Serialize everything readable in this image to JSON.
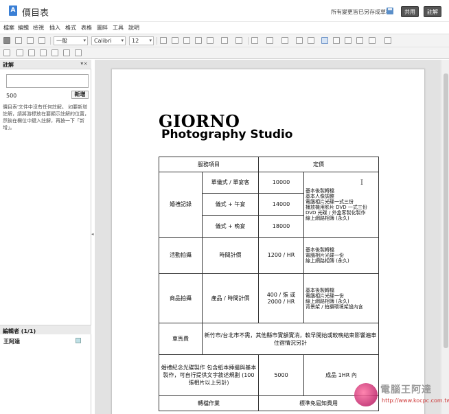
{
  "app": {
    "doc_icon": "A",
    "doc_title": "價目表",
    "save_status": "所有變更皆已另存成草稿",
    "share_label": "共用",
    "comment_label": "註解"
  },
  "menu": [
    "檔案",
    "編輯",
    "檢視",
    "插入",
    "格式",
    "表格",
    "圖畔",
    "工具",
    "說明"
  ],
  "toolbar": {
    "style_value": "一般",
    "font_value": "Calibri",
    "size_value": "12"
  },
  "comments_panel": {
    "title": "註解",
    "count": "500",
    "add_button": "新增",
    "hint": "價目表'文件中沒有任何註解。 如要新增註解，請將游標放在要顯示註解的位置，然後在欄位中鍵入註解，再按一下「新增」。",
    "editors_title": "編輯者 (1/1)",
    "editor_name": "王阿達",
    "editor_color": "#bfe0e6"
  },
  "document": {
    "brand_line1": "GIORNO",
    "brand_line2": "Photography Studio",
    "table": {
      "header_service": "服務項目",
      "header_price": "定價",
      "wedding_label": "婚禮記錄",
      "wedding_rows": [
        {
          "item": "單儀式 / 單宴客",
          "price": "10000"
        },
        {
          "item": "儀式 + 午宴",
          "price": "14000"
        },
        {
          "item": "儀式 + 晚宴",
          "price": "18000"
        }
      ],
      "wedding_details": [
        "基本後製轉檔",
        "基本人像調整",
        "電腦相片光碟一式三份",
        "播放機用影片 DVD 一式三份",
        "DVD 光碟 / 外盒客製化製作",
        "線上網路相簿 (永久)"
      ],
      "event_label": "活動拍攝",
      "event_item": "時間計價",
      "event_price": "1200 / HR",
      "event_details": [
        "基本後製轉檔",
        "電腦相片光碟一份",
        "線上網路相簿 (永久)"
      ],
      "product_label": "商品拍攝",
      "product_item": "產品 / 時間計價",
      "product_price_line1": "400 / 張 或",
      "product_price_line2": "2000 / HR",
      "product_details": [
        "基本後製轉檔",
        "電腦相片光碟一份",
        "線上網路相簿 (永久)",
        "背景架 / 拍攝環境架設內含"
      ],
      "travel_label": "車馬費",
      "travel_desc": "新竹市/台北市不需，其他縣市實額實消，較早開始或較晚結束影響遍車住宿情況另計",
      "disc_desc": "婚禮紀念光碟製作 包含紙本揷撮與基本製作，可自行提供文字敘述規劃 (100 張相片以上另計)",
      "disc_price": "5000",
      "disc_note": "成品 1HR 內",
      "last_left": "轉檔作業",
      "last_right": "標準免屆知費用"
    }
  },
  "watermark": {
    "title": "電腦王阿達",
    "url": "http://www.kocpc.com.tw"
  }
}
